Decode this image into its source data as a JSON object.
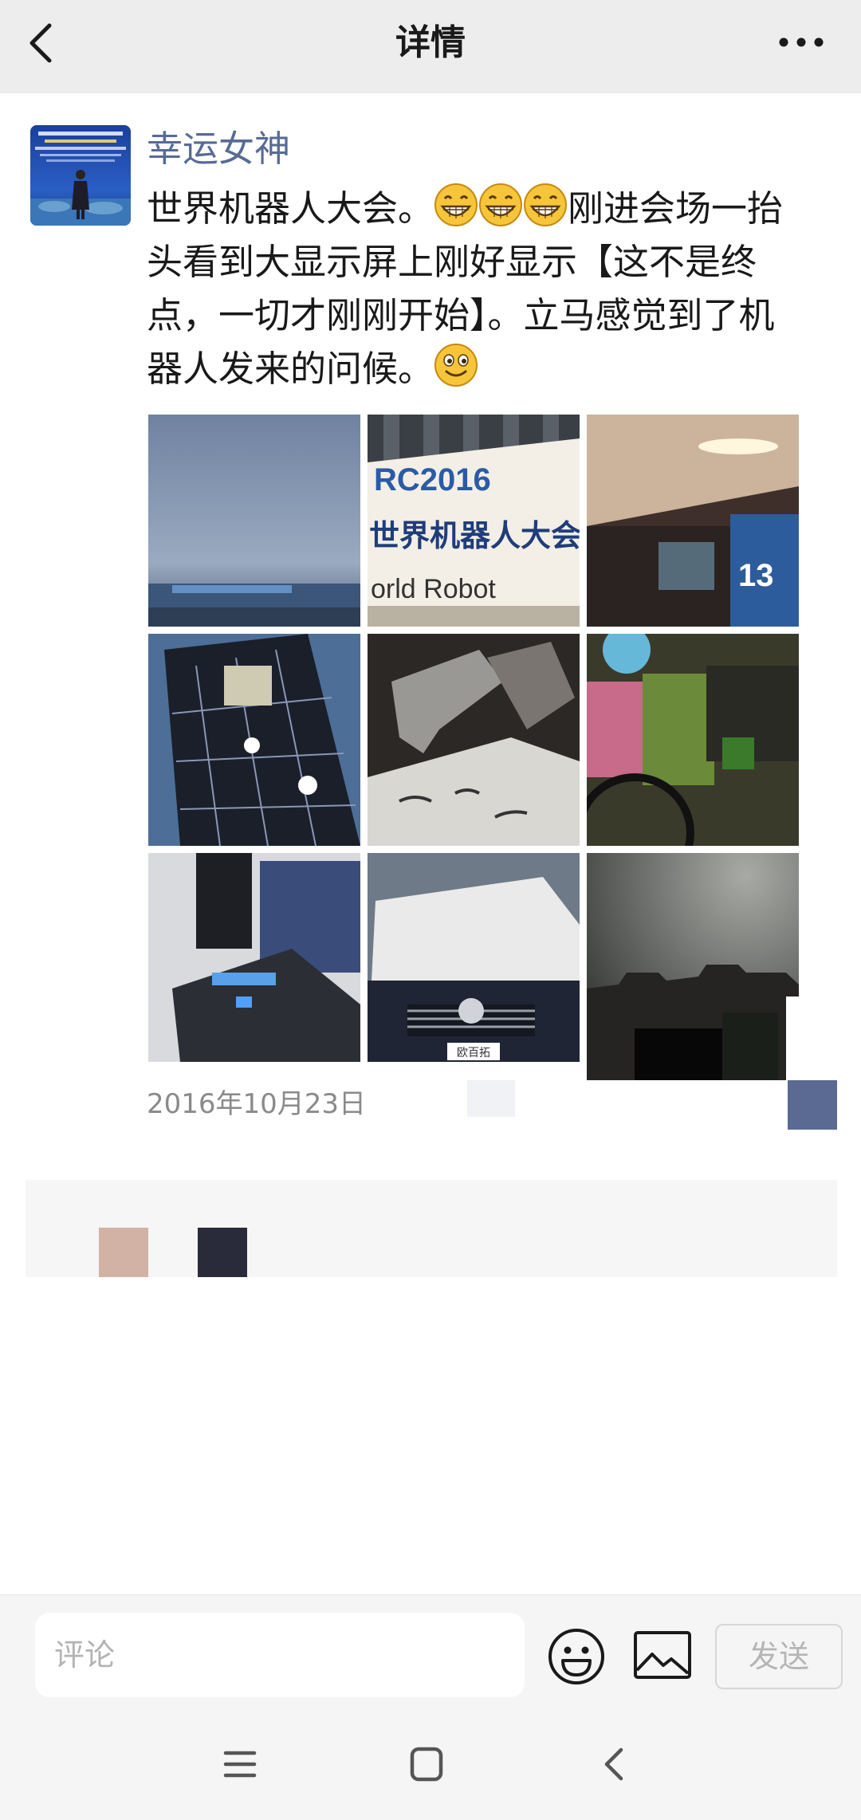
{
  "header": {
    "title": "详情",
    "back_icon": "chevron-left-icon",
    "more_icon": "more-horizontal-icon",
    "background": "#ededed"
  },
  "post": {
    "author": "幸运女神",
    "author_color": "#576b95",
    "text_line1_prefix": "世界机器人大会。",
    "text_line1_suffix": "刚进会场一抬",
    "text_line2": "头看到大显示屏上刚好显示【这不是终",
    "text_line3": "点，一切才刚刚开始】。立马感觉到了机",
    "text_line4_prefix": "器人发来的问候。",
    "emojis": [
      "grin-emoji",
      "grin-emoji",
      "grin-emoji",
      "smile-emoji"
    ],
    "photo_count": 9,
    "photo_sign_text": "RC2016",
    "photo_sign_text_cn": "世界机器人大会无人",
    "photo_sign_text_en": "orld Robot",
    "photo_hall_number": "13",
    "photo_car_badge": "欧百拓",
    "date": "2016年10月23日"
  },
  "input_bar": {
    "placeholder": "评论",
    "emoji_icon": "emoji-face-icon",
    "image_icon": "image-icon",
    "send_label": "发送"
  },
  "nav": {
    "menu_icon": "menu-icon",
    "home_icon": "home-square-icon",
    "back_icon": "back-triangle-icon"
  }
}
